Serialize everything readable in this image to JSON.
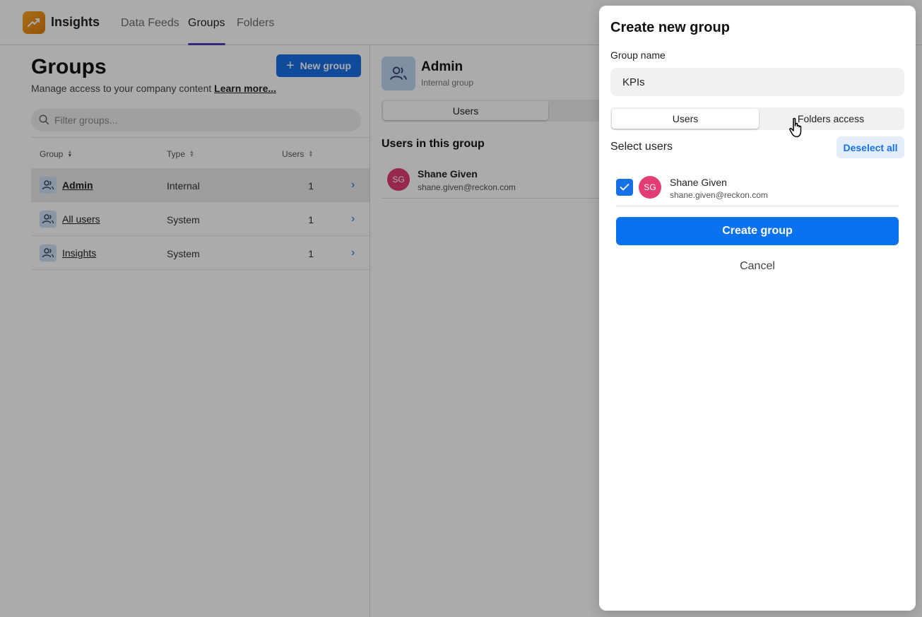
{
  "app": {
    "name": "Insights"
  },
  "nav": {
    "tabs": [
      {
        "label": "Data Feeds"
      },
      {
        "label": "Groups"
      },
      {
        "label": "Folders"
      }
    ],
    "active": "Groups"
  },
  "groups_page": {
    "title": "Groups",
    "subtitle": "Manage access to your company content",
    "learn_more": "Learn more...",
    "new_group_label": "New group",
    "filter_placeholder": "Filter groups...",
    "columns": {
      "group": "Group",
      "type": "Type",
      "users": "Users"
    },
    "rows": [
      {
        "name": "Admin",
        "type": "Internal",
        "users": "1"
      },
      {
        "name": "All users",
        "type": "System",
        "users": "1"
      },
      {
        "name": "Insights",
        "type": "System",
        "users": "1"
      }
    ]
  },
  "detail": {
    "title": "Admin",
    "subtitle": "Internal group",
    "tab_users": "Users",
    "section_title": "Users in this group",
    "user": {
      "initials": "SG",
      "name": "Shane Given",
      "email": "shane.given@reckon.com"
    }
  },
  "modal": {
    "title": "Create new group",
    "group_name_label": "Group name",
    "group_name_value": "KPIs",
    "tabs": {
      "users": "Users",
      "folders_access": "Folders access"
    },
    "select_users_label": "Select users",
    "deselect_all_label": "Deselect all",
    "user": {
      "initials": "SG",
      "name": "Shane Given",
      "email": "shane.given@reckon.com",
      "checked": true
    },
    "create_label": "Create group",
    "cancel_label": "Cancel"
  },
  "colors": {
    "accent": "#1770e6",
    "avatar": "#e23c74",
    "logo": "#f0921a",
    "nav_underline": "#4b3fb5"
  },
  "icons": [
    "trend-icon",
    "plus-icon",
    "search-icon",
    "sort-icon",
    "group-icon",
    "chevron-right-icon",
    "check-icon",
    "hand-cursor-icon"
  ]
}
